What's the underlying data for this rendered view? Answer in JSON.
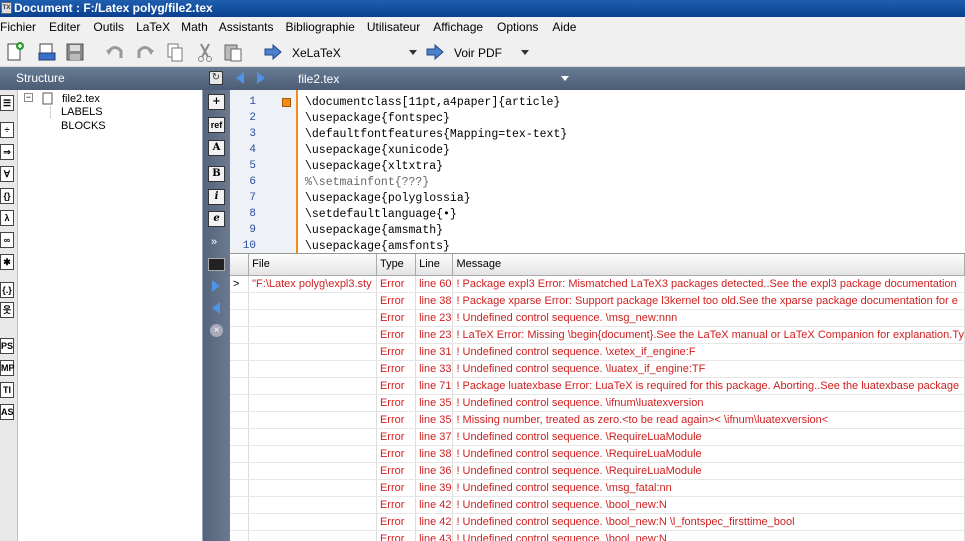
{
  "window": {
    "title": "Document : F:/Latex polyg/file2.tex"
  },
  "menu": [
    "Fichier",
    "Editer",
    "Outils",
    "LaTeX",
    "Math",
    "Assistants",
    "Bibliographie",
    "Utilisateur",
    "Affichage",
    "Options",
    "Aide"
  ],
  "toolbar": {
    "compiler_label": "XeLaTeX",
    "viewer_label": "Voir PDF"
  },
  "structure": {
    "title": "Structure",
    "tree": [
      {
        "label": "file2.tex"
      },
      {
        "label": "LABELS"
      },
      {
        "label": "BLOCKS"
      }
    ],
    "left_icons": [
      "ls-icon-1",
      "ls-icon-2",
      "ls-icon-3",
      "ls-icon-4",
      "ls-icon-5",
      "ls-icon-6",
      "ls-icon-7",
      "ls-icon-8",
      "ls-icon-9",
      "ls-icon-10",
      "ls-icon-11",
      "ls-icon-12",
      "ls-icon-13",
      "ls-icon-14"
    ],
    "left_labels": [
      "",
      "",
      "",
      "",
      "{}",
      "λ",
      "∞",
      "",
      "{.}",
      "",
      "PS",
      "MP",
      "TI",
      "AS"
    ]
  },
  "editor": {
    "file_tab": "file2.tex",
    "lines": [
      {
        "num": "1",
        "text": "\\documentclass[11pt,a4paper]{article}"
      },
      {
        "num": "2",
        "text": "\\usepackage{fontspec}"
      },
      {
        "num": "3",
        "text": "\\defaultfontfeatures{Mapping=tex-text}"
      },
      {
        "num": "4",
        "text": "\\usepackage{xunicode}"
      },
      {
        "num": "5",
        "text": "\\usepackage{xltxtra}"
      },
      {
        "num": "6",
        "text": "%\\setmainfont{???}"
      },
      {
        "num": "7",
        "text": "\\usepackage{polyglossia}"
      },
      {
        "num": "8",
        "text": "\\setdefaultlanguage{•}"
      },
      {
        "num": "9",
        "text": "\\usepackage{amsmath}"
      },
      {
        "num": "10",
        "text": "\\usepackage{amsfonts}"
      }
    ],
    "side_buttons": [
      "+",
      "ref",
      "A",
      "B",
      "i",
      "e",
      "»"
    ]
  },
  "log": {
    "headers": [
      "",
      "File",
      "Type",
      "Line",
      "Message"
    ],
    "rows": [
      {
        "marker": ">",
        "file": "\"F:\\Latex polyg\\expl3.sty",
        "type": "Error",
        "line": "line 60",
        "message": "! Package expl3 Error: Mismatched LaTeX3 packages detected..See the expl3 package documentation"
      },
      {
        "marker": "",
        "file": "",
        "type": "Error",
        "line": "line 38",
        "message": "! Package xparse Error: Support package l3kernel too old.See the xparse package documentation for e"
      },
      {
        "marker": "",
        "file": "",
        "type": "Error",
        "line": "line 23",
        "message": "! Undefined control sequence. \\msg_new:nnn"
      },
      {
        "marker": "",
        "file": "",
        "type": "Error",
        "line": "line 23",
        "message": "! LaTeX Error: Missing \\begin{document}.See the LaTeX manual or LaTeX Companion for explanation.Ty"
      },
      {
        "marker": "",
        "file": "",
        "type": "Error",
        "line": "line 31",
        "message": "! Undefined control sequence. \\xetex_if_engine:F"
      },
      {
        "marker": "",
        "file": "",
        "type": "Error",
        "line": "line 33",
        "message": "! Undefined control sequence. \\luatex_if_engine:TF"
      },
      {
        "marker": "",
        "file": "",
        "type": "Error",
        "line": "line 71",
        "message": "! Package luatexbase Error: LuaTeX is required for this package. Aborting..See the luatexbase package"
      },
      {
        "marker": "",
        "file": "",
        "type": "Error",
        "line": "line 35",
        "message": "! Undefined control sequence. \\ifnum\\luatexversion"
      },
      {
        "marker": "",
        "file": "",
        "type": "Error",
        "line": "line 35",
        "message": "! Missing number, treated as zero.<to be read again>< \\ifnum\\luatexversion<"
      },
      {
        "marker": "",
        "file": "",
        "type": "Error",
        "line": "line 37",
        "message": "! Undefined control sequence. \\RequireLuaModule"
      },
      {
        "marker": "",
        "file": "",
        "type": "Error",
        "line": "line 38",
        "message": "! Undefined control sequence. \\RequireLuaModule"
      },
      {
        "marker": "",
        "file": "",
        "type": "Error",
        "line": "line 36",
        "message": "! Undefined control sequence. \\RequireLuaModule"
      },
      {
        "marker": "",
        "file": "",
        "type": "Error",
        "line": "line 39",
        "message": "! Undefined control sequence. \\msg_fatal:nn"
      },
      {
        "marker": "",
        "file": "",
        "type": "Error",
        "line": "line 42",
        "message": "! Undefined control sequence. \\bool_new:N"
      },
      {
        "marker": "",
        "file": "",
        "type": "Error",
        "line": "line 42",
        "message": "! Undefined control sequence. \\bool_new:N \\l_fontspec_firsttime_bool"
      },
      {
        "marker": "",
        "file": "",
        "type": "Error",
        "line": "line 43",
        "message": "! Undefined control sequence. \\bool_new:N"
      }
    ]
  },
  "colors": {
    "error_text": "#d02020",
    "panel_header": "#5a6b84",
    "title_bar": "#1a56a6"
  }
}
